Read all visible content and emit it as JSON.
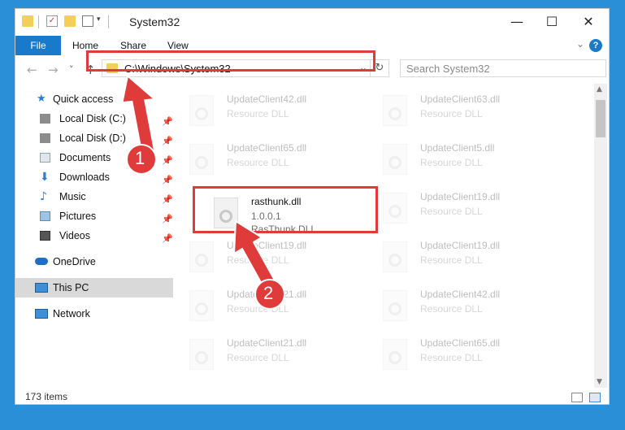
{
  "window": {
    "title": "System32",
    "minimize": "—",
    "maximize": "☐",
    "close": "✕"
  },
  "ribbon": {
    "file": "File",
    "home": "Home",
    "share": "Share",
    "view": "View"
  },
  "nav": {
    "back": "←",
    "forward": "→",
    "recent": "˅",
    "up": "↑",
    "address": "C:\\Windows\\System32",
    "search_placeholder": "Search System32"
  },
  "sidebar": {
    "quick_access": "Quick access",
    "items": [
      {
        "label": "Local Disk (C:)",
        "icon": "drive-icon"
      },
      {
        "label": "Local Disk (D:)",
        "icon": "drive-icon"
      },
      {
        "label": "Documents",
        "icon": "documents-icon"
      },
      {
        "label": "Downloads",
        "icon": "downloads-icon"
      },
      {
        "label": "Music",
        "icon": "music-icon"
      },
      {
        "label": "Pictures",
        "icon": "pictures-icon"
      },
      {
        "label": "Videos",
        "icon": "videos-icon"
      }
    ],
    "onedrive": "OneDrive",
    "thispc": "This PC",
    "network": "Network"
  },
  "files": [
    {
      "name": "UpdateClient42.dll",
      "desc": "Resource DLL"
    },
    {
      "name": "UpdateClient63.dll",
      "desc": "Resource DLL"
    },
    {
      "name": "UpdateClient65.dll",
      "desc": "Resource DLL"
    },
    {
      "name": "UpdateClient5.dll",
      "desc": "Resource DLL"
    },
    {
      "name": "rasthunk.dll",
      "version": "1.0.0.1",
      "desc": "RasThunk DLL"
    },
    {
      "name": "UpdateClient19.dll",
      "desc": "Resource DLL"
    },
    {
      "name": "UpdateClient19.dll",
      "desc": "Resource DLL"
    },
    {
      "name": "UpdateClient19.dll",
      "desc": "Resource DLL"
    },
    {
      "name": "UpdateClient21.dll",
      "desc": "Resource DLL"
    },
    {
      "name": "UpdateClient42.dll",
      "desc": "Resource DLL"
    },
    {
      "name": "UpdateClient21.dll",
      "desc": "Resource DLL"
    },
    {
      "name": "UpdateClient65.dll",
      "desc": "Resource DLL"
    }
  ],
  "annotations": {
    "step1": "1",
    "step2": "2"
  },
  "status": {
    "count": "173 items"
  },
  "colors": {
    "accent": "#1979ca",
    "highlight_red": "#e03b3b",
    "background": "#2a8fd6"
  }
}
